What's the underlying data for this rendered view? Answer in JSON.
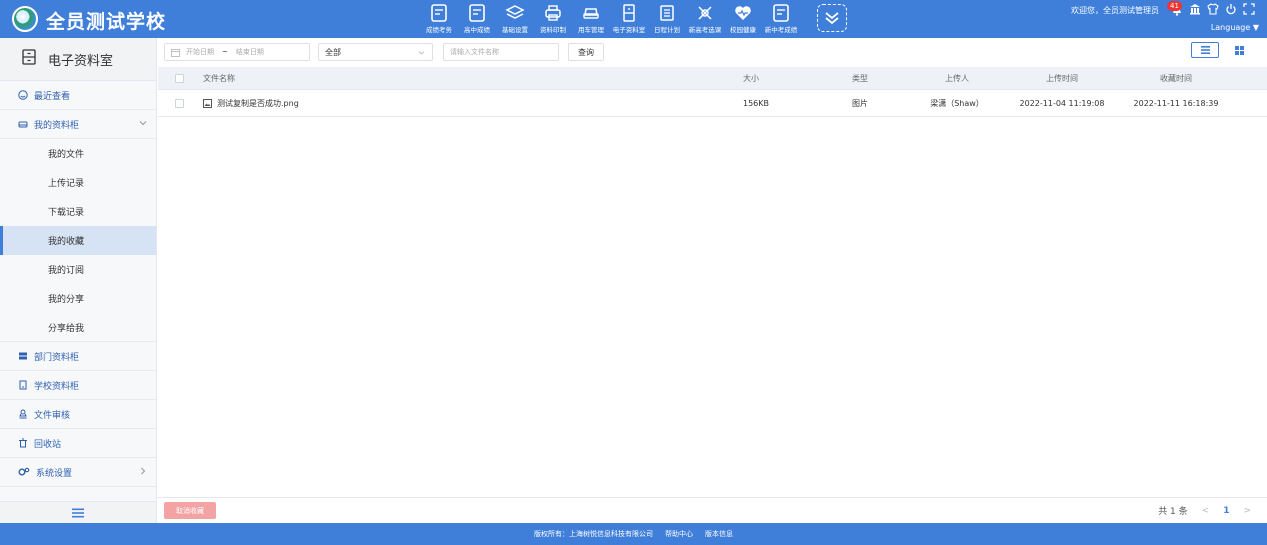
{
  "header": {
    "school_name": "全员测试学校",
    "modules": [
      {
        "label": "成绩考务",
        "icon": "report-icon"
      },
      {
        "label": "高中成绩",
        "icon": "report-icon"
      },
      {
        "label": "基础设置",
        "icon": "layers-icon"
      },
      {
        "label": "资料印制",
        "icon": "printer-icon"
      },
      {
        "label": "用车管理",
        "icon": "car-icon"
      },
      {
        "label": "电子资料室",
        "icon": "cabinet-icon"
      },
      {
        "label": "日程计划",
        "icon": "calendar-icon"
      },
      {
        "label": "新高考选课",
        "icon": "scale-icon"
      },
      {
        "label": "校园健康",
        "icon": "heart-icon"
      },
      {
        "label": "新中考成绩",
        "icon": "report-icon"
      }
    ],
    "welcome": "欢迎您，全员测试管理员",
    "notification_count": "41",
    "language": "Language"
  },
  "sidebar": {
    "title": "电子资料室",
    "recent": "最近查看",
    "my_cabinet": "我的资料柜",
    "sub_items": [
      "我的文件",
      "上传记录",
      "下载记录",
      "我的收藏",
      "我的订阅",
      "我的分享",
      "分享给我"
    ],
    "active_sub": "我的收藏",
    "dept_cabinet": "部门资料柜",
    "school_cabinet": "学校资料柜",
    "file_review": "文件审核",
    "recycle_bin": "回收站",
    "system_settings": "系统设置"
  },
  "toolbar": {
    "start_date_placeholder": "开始日期",
    "date_separator": "~",
    "end_date_placeholder": "结束日期",
    "type_select_value": "全部",
    "search_placeholder": "请输入文件名称",
    "query_label": "查询"
  },
  "table": {
    "columns": [
      "文件名称",
      "大小",
      "类型",
      "上传人",
      "上传时间",
      "收藏时间"
    ],
    "rows": [
      {
        "name": "测试复制是否成功.png",
        "size": "156KB",
        "type": "图片",
        "uploader": "梁潇（Shaw）",
        "upload_time": "2022-11-04 11:19:08",
        "favorite_time": "2022-11-11 16:18:39"
      }
    ]
  },
  "bottom": {
    "cancel_label": "取消收藏",
    "total": "共 1 条",
    "prev": "<",
    "page": "1",
    "next": ">"
  },
  "footer": {
    "copyright": "版权所有：上海树悦信息科技有限公司",
    "help": "帮助中心",
    "version": "版本信息"
  },
  "colors": {
    "primary": "#3f7fd9",
    "sidebar_bg": "#f7f8fa",
    "active_bg": "#d6e3f5",
    "cancel_button": "#f3a3a3"
  }
}
